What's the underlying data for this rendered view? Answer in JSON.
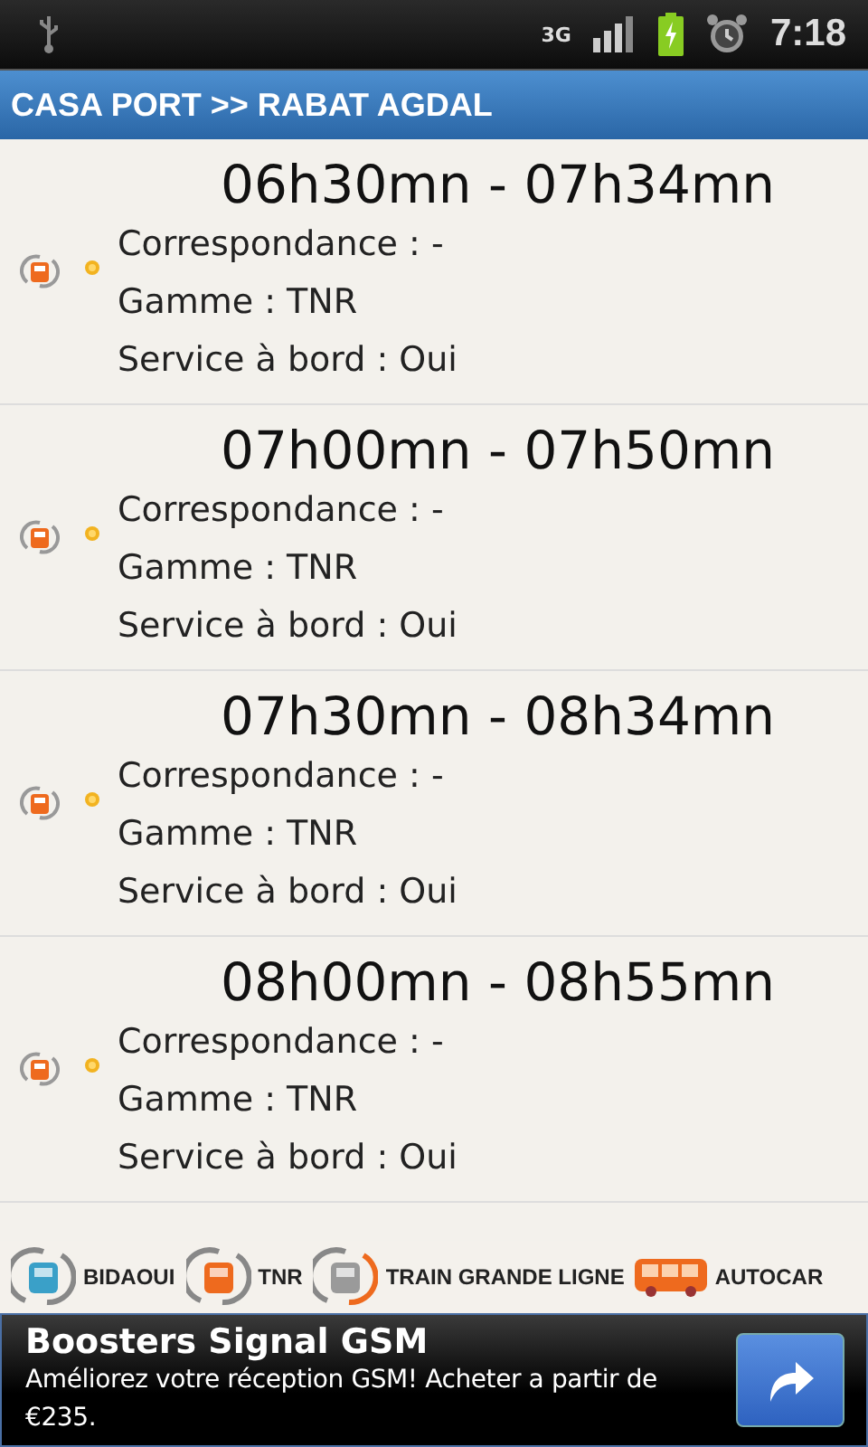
{
  "status_bar": {
    "network": "3G",
    "time": "7:18"
  },
  "title": "CASA PORT >> RABAT AGDAL",
  "trips": [
    {
      "time": "06h30mn - 07h34mn",
      "lines": [
        "Correspondance : -",
        "Gamme : TNR",
        "Service à bord : Oui"
      ]
    },
    {
      "time": "07h00mn - 07h50mn",
      "lines": [
        "Correspondance : -",
        "Gamme : TNR",
        "Service à bord : Oui"
      ]
    },
    {
      "time": "07h30mn - 08h34mn",
      "lines": [
        "Correspondance : -",
        "Gamme : TNR",
        "Service à bord : Oui"
      ]
    },
    {
      "time": "08h00mn - 08h55mn",
      "lines": [
        "Correspondance : -",
        "Gamme : TNR",
        "Service à bord : Oui"
      ]
    }
  ],
  "legend": [
    {
      "kind": "bidaoui",
      "label": "BIDAOUI"
    },
    {
      "kind": "tnr",
      "label": "TNR"
    },
    {
      "kind": "grande",
      "label": "TRAIN GRANDE LIGNE"
    },
    {
      "kind": "autocar",
      "label": "AUTOCAR"
    }
  ],
  "ad": {
    "title": "Boosters Signal GSM",
    "text": "Améliorez votre réception GSM! Acheter a partir de €235."
  }
}
